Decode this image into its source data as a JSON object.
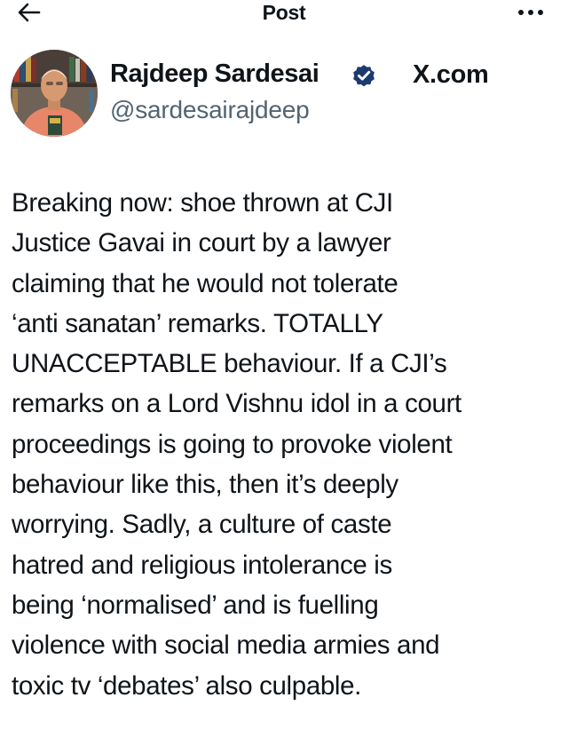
{
  "header": {
    "title": "Post",
    "back_icon": "arrow-left-icon",
    "more_icon": "more-dots-icon"
  },
  "author": {
    "name": "Rajdeep Sardesai",
    "handle": "@sardesairajdeep",
    "verified": true,
    "badge_color": "#1d3a70",
    "avatar_icon": "avatar-photo"
  },
  "source": {
    "label": "X.com"
  },
  "tweet": {
    "lines": [
      "Breaking now: shoe thrown at CJI",
      "Justice Gavai in court by a lawyer",
      "claiming that he would not tolerate",
      "‘anti sanatan’ remarks. TOTALLY",
      "UNACCEPTABLE behaviour. If a CJI’s",
      "remarks on a Lord Vishnu idol in a court",
      "proceedings is going to provoke violent",
      "behaviour like this, then it’s deeply",
      "worrying. Sadly, a culture of caste",
      "hatred and religious intolerance is",
      "being ‘normalised’ and is fuelling",
      "violence with social media armies and",
      "toxic tv ‘debates’ also culpable."
    ]
  }
}
